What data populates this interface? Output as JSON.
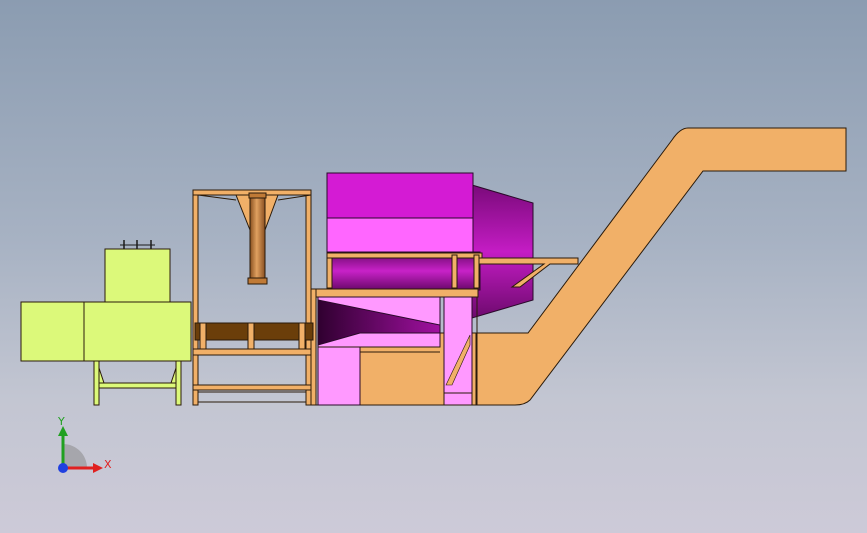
{
  "viewport": {
    "background_top": "#8b9cb1",
    "background_bottom": "#cdcad8"
  },
  "model": {
    "colors": {
      "conveyor": "#f1b068",
      "frame": "#f1b068",
      "drum_dark": "#b21ab2",
      "drum_mid": "#d41bd4",
      "drum_light": "#ff66ff",
      "drum_side": "#a010a0",
      "hopper_pink": "#ff99ff",
      "motor": "#dcf97a",
      "cylinder": "#c07a36",
      "beam_dark": "#6b3e0a"
    }
  },
  "triad": {
    "x_label": "X",
    "y_label": "Y",
    "x_color": "#e02020",
    "y_color": "#20a020",
    "z_color": "#2040e0"
  }
}
